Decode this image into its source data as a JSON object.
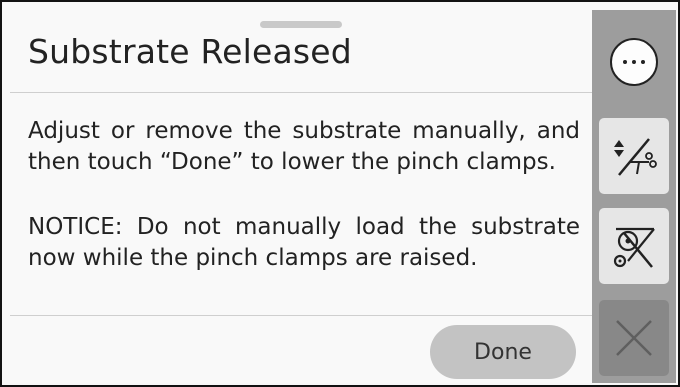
{
  "dialog": {
    "title": "Substrate Released",
    "paragraphs": [
      "Adjust or remove the substrate manually, and then touch “Done” to lower the pinch clamps.",
      "NOTICE: Do not manually load the substrate now while the pinch clamps are raised."
    ],
    "done_label": "Done"
  },
  "side_panel": {
    "buttons": [
      {
        "icon": "more-options-icon"
      },
      {
        "icon": "move-and-cut-substrate-icon"
      },
      {
        "icon": "substrate-path-disabled-icon"
      },
      {
        "icon": "close-icon",
        "state": "disabled"
      }
    ]
  },
  "colors": {
    "panel_bg": "#9d9d9d",
    "tile_bg": "#e6e6e6",
    "tile_disabled_bg": "#888888",
    "done_button_bg": "#c3c3c3"
  }
}
